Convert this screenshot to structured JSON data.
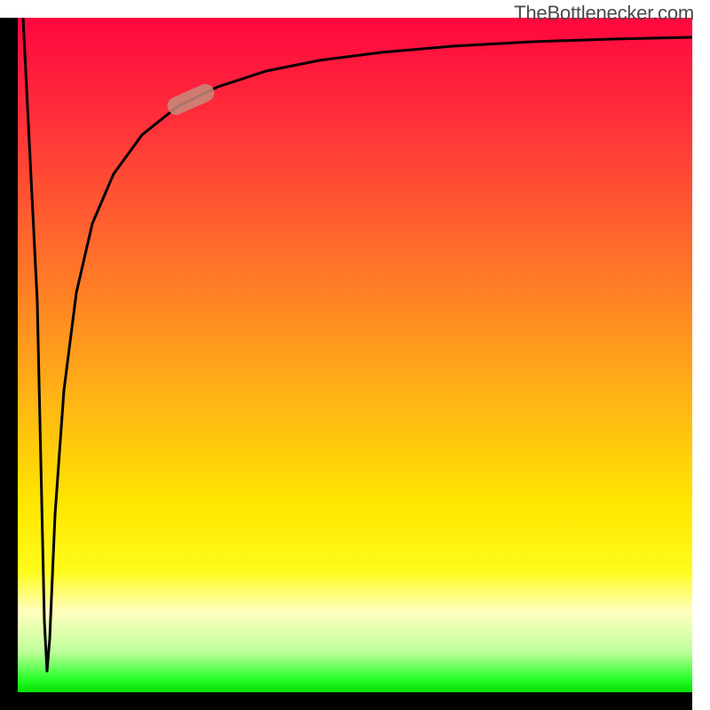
{
  "attribution": "TheBottlenecker.com",
  "colors": {
    "axis": "#000000",
    "curve": "#000000",
    "marker_fill": "#c78b7d",
    "gradient_top": "#ff063f",
    "gradient_mid": "#ffe600",
    "gradient_bottom": "#00e000"
  },
  "chart_data": {
    "type": "line",
    "title": "",
    "xlabel": "",
    "ylabel": "",
    "xlim": [
      0,
      100
    ],
    "ylim": [
      0,
      100
    ],
    "x": [
      0,
      2,
      3,
      4,
      5,
      6,
      8,
      10,
      12,
      15,
      18,
      22,
      26,
      30,
      40,
      50,
      60,
      70,
      80,
      90,
      100
    ],
    "values": [
      100,
      50,
      10,
      3,
      20,
      40,
      58,
      68,
      74,
      79,
      82,
      85,
      87.5,
      89,
      91.5,
      93,
      94,
      95,
      95.7,
      96.3,
      96.8
    ],
    "marker": {
      "x": 26,
      "y": 87.5
    },
    "note": "x/y are fractional positions across the plot; values near x≈4 dip to ~3 (bottom) then rise toward a plateau ~97."
  }
}
